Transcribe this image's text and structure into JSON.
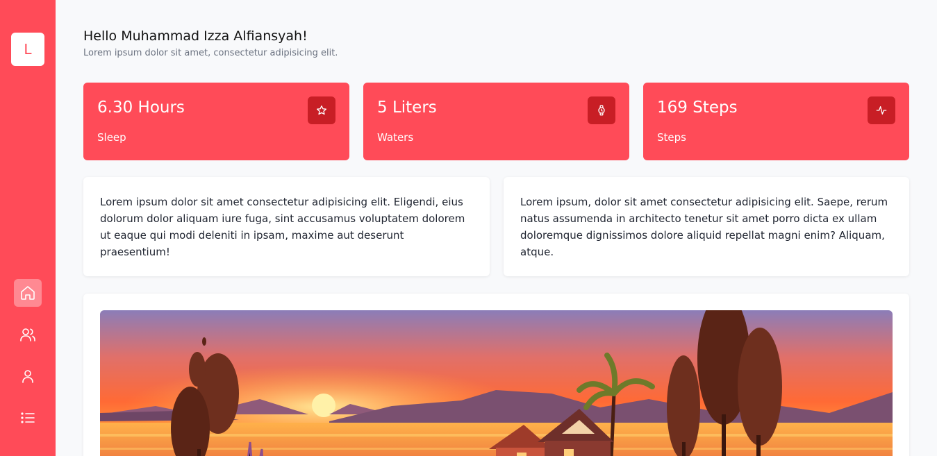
{
  "sidebar": {
    "logo_letter": "L",
    "nav": [
      {
        "icon": "home-icon",
        "active": true
      },
      {
        "icon": "users-icon",
        "active": false
      },
      {
        "icon": "user-icon",
        "active": false
      },
      {
        "icon": "list-icon",
        "active": false
      }
    ]
  },
  "header": {
    "greeting": "Hello Muhammad Izza Alfiansyah!",
    "subtitle": "Lorem ipsum dolor sit amet, consectetur adipisicing elit."
  },
  "stats": [
    {
      "value": "6.30 Hours",
      "label": "Sleep",
      "icon": "star-icon"
    },
    {
      "value": "5 Liters",
      "label": "Waters",
      "icon": "watch-icon"
    },
    {
      "value": "169 Steps",
      "label": "Steps",
      "icon": "activity-icon"
    }
  ],
  "texts": [
    "Lorem ipsum dolor sit amet consectetur adipisicing elit. Eligendi, eius dolorum dolor aliquam iure fuga, sint accusamus voluptatem dolorem ut eaque qui modi deleniti in ipsam, maxime aut deserunt praesentium!",
    "Lorem ipsum, dolor sit amet consectetur adipisicing elit. Saepe, rerum natus assumenda in architecto tenetur sit amet porro dicta ex ullam doloremque dignissimos dolore aliquid repellat magni enim? Aliquam, atque."
  ],
  "colors": {
    "accent": "#ff4b58",
    "accent_dark": "#c81e25",
    "background": "#f8f9fb"
  }
}
